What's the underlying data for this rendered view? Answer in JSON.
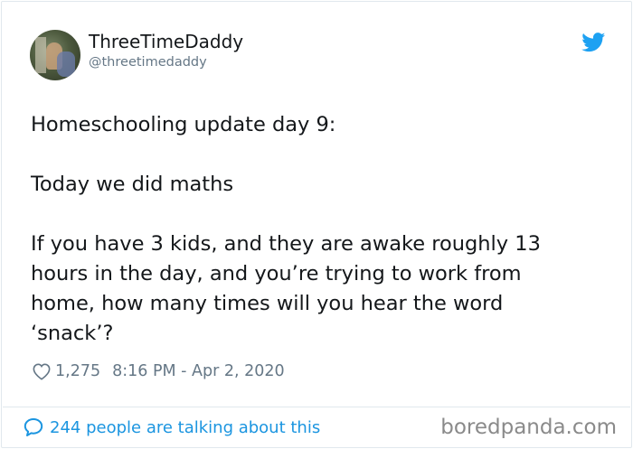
{
  "tweet": {
    "display_name": "ThreeTimeDaddy",
    "handle": "@threetimedaddy",
    "text": "Homeschooling update day 9:\n\nToday we did maths\n\nIf you have 3 kids, and they are awake roughly 13\nhours in the day, and you’re trying to work from\nhome, how many times will you hear the word\n‘snack’?",
    "likes": "1,275",
    "timestamp": "8:16 PM - Apr 2, 2020",
    "conversation": "244 people are talking about this"
  },
  "watermark": "boredpanda.com",
  "colors": {
    "twitter_blue": "#1da1f2",
    "link_blue": "#1b95e0",
    "meta_gray": "#657786"
  },
  "icons": [
    "twitter-bird-icon",
    "heart-icon",
    "speech-bubble-icon"
  ]
}
